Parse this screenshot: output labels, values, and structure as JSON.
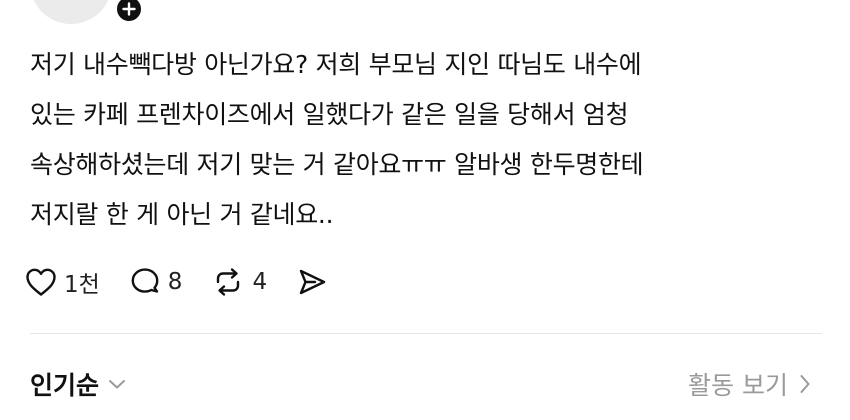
{
  "post": {
    "text_lines": [
      "저기 내수빽다방 아닌가요? 저희 부모님 지인 따님도 내수에",
      "있는 카페 프렌차이즈에서 일했다가 같은 일을 당해서 엄청",
      "속상해하셨는데 저기 맞는 거 같아요ㅠㅠ 알바생 한두명한테",
      "저지랄 한 게 아닌 거 같네요.."
    ]
  },
  "actions": {
    "like": {
      "icon": "heart-icon",
      "count": "1천"
    },
    "comment": {
      "icon": "comment-icon",
      "count": "8"
    },
    "repost": {
      "icon": "repost-icon",
      "count": "4"
    },
    "share": {
      "icon": "send-icon"
    }
  },
  "replies_header": {
    "sort_label": "인기순",
    "sort_icon": "chevron-down-icon",
    "activity_label": "활동 보기",
    "activity_icon": "chevron-right-icon"
  },
  "colors": {
    "text": "#111111",
    "muted": "#9a9a9a",
    "divider": "#e6e6e6"
  }
}
